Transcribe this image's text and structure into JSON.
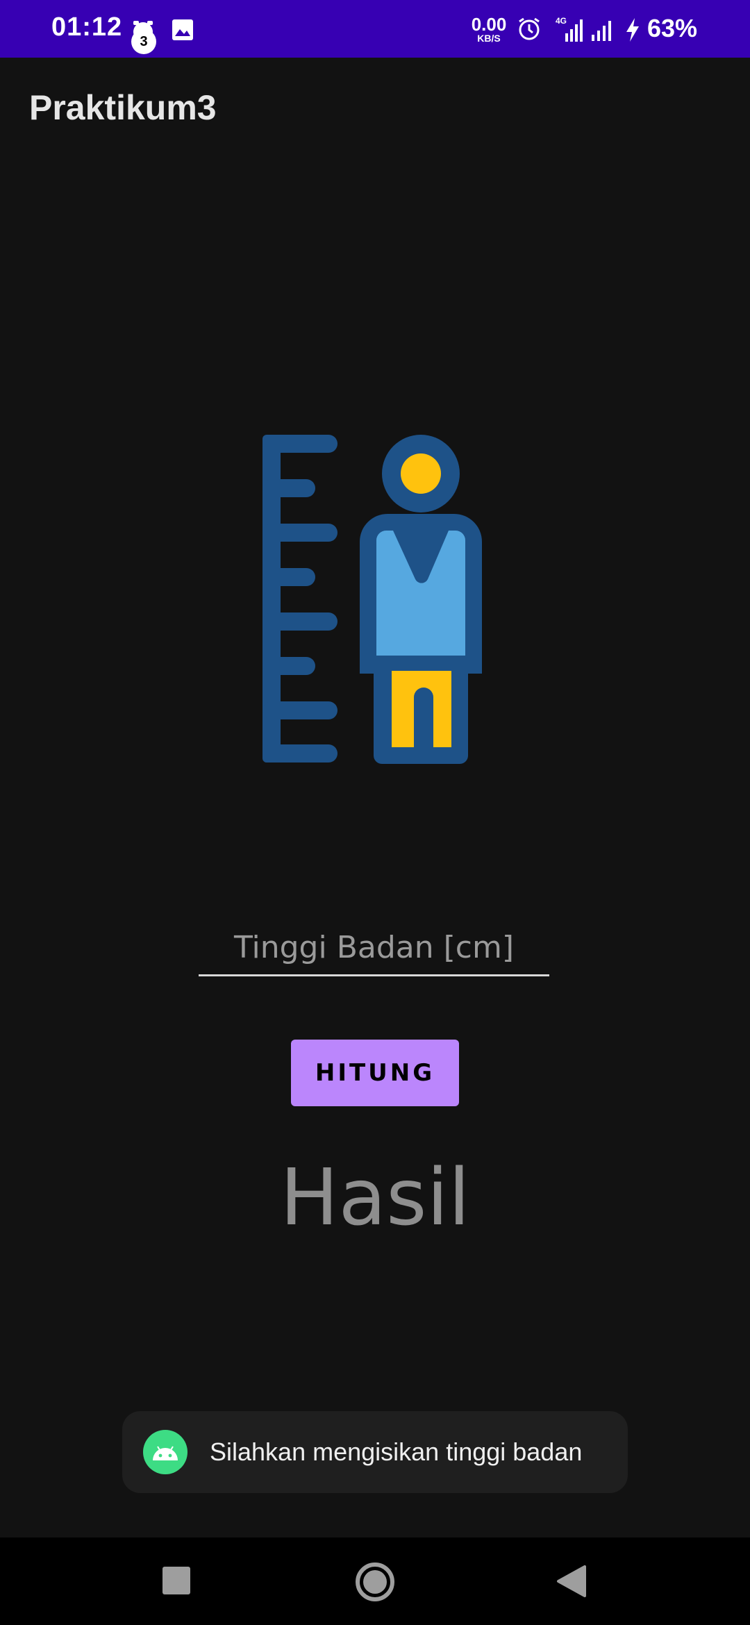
{
  "status_bar": {
    "time": "01:12",
    "notification_count": "3",
    "net_speed_value": "0.00",
    "net_speed_unit": "KB/S",
    "network_type": "4G",
    "battery": "63%",
    "icons": [
      "alarm-clock-icon",
      "image-icon",
      "alarm-icon",
      "signal-icon",
      "signal-icon",
      "charging-bolt-icon"
    ]
  },
  "app_bar": {
    "title": "Praktikum3"
  },
  "form": {
    "height_placeholder": "Tinggi Badan [cm]",
    "height_value": "",
    "calculate_label": "HITUNG"
  },
  "result": {
    "text": "Hasil"
  },
  "toast": {
    "message": "Silahkan mengisikan tinggi badan"
  },
  "colors": {
    "status_bar": "#3700b3",
    "background": "#121212",
    "button": "#bb86fc",
    "illustration_dark_blue": "#1e5288",
    "illustration_light_blue": "#56a8e0",
    "illustration_yellow": "#ffc20e",
    "android_green": "#3ddc84"
  }
}
